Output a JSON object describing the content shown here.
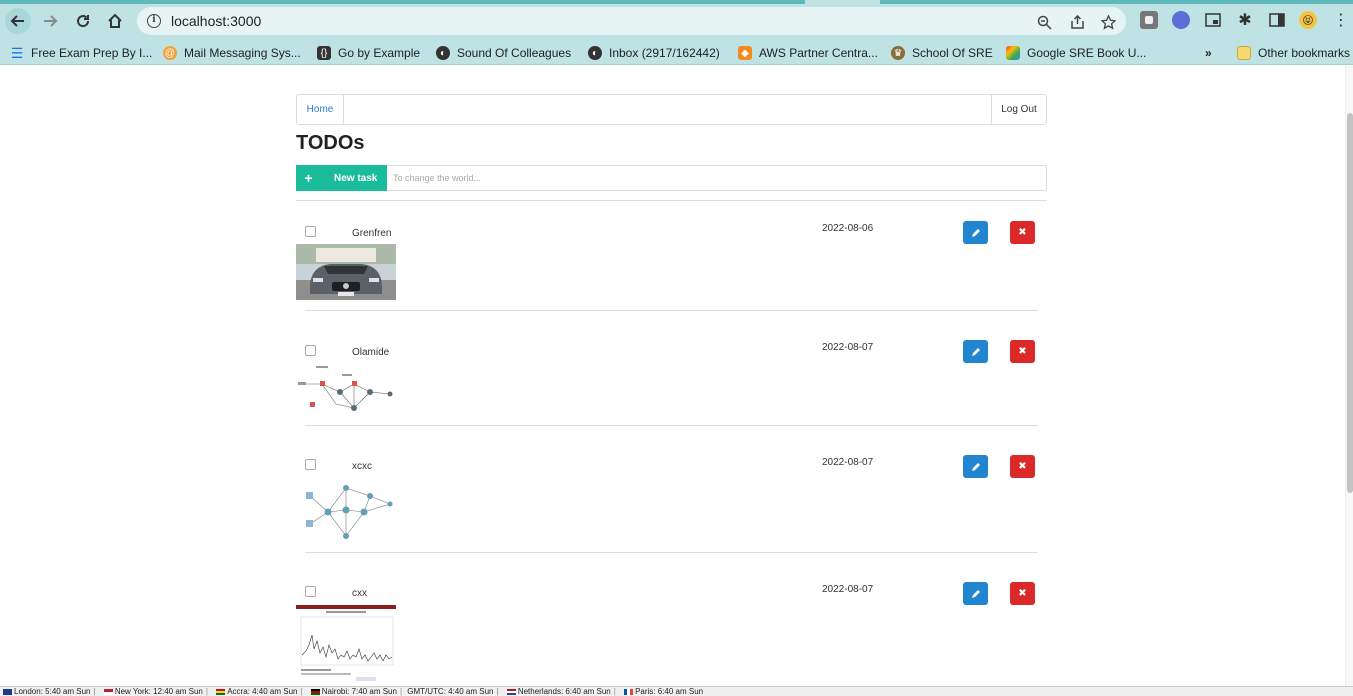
{
  "browser": {
    "url": "localhost:3000",
    "bookmarks": [
      {
        "label": "Free Exam Prep By I...",
        "icon": "list-icon",
        "color": "#1a73e8"
      },
      {
        "label": "Mail Messaging Sys...",
        "icon": "mail-icon",
        "color": "#f2a23a"
      },
      {
        "label": "Go by Example",
        "icon": "code-icon",
        "color": "#333333"
      },
      {
        "label": "Sound Of Colleagues",
        "icon": "globe-icon",
        "color": "#333333"
      },
      {
        "label": "Inbox (2917/162442)",
        "icon": "globe-icon",
        "color": "#333333"
      },
      {
        "label": "AWS Partner Centra...",
        "icon": "cube-icon",
        "color": "#f58a1f"
      },
      {
        "label": "School Of SRE",
        "icon": "crest-icon",
        "color": "#8a6d3b"
      },
      {
        "label": "Google SRE Book U...",
        "icon": "colorful-icon",
        "color": "#6b4fbb"
      }
    ],
    "overflow_label": "»",
    "other_bookmarks": "Other bookmarks"
  },
  "app": {
    "nav": {
      "home": "Home",
      "logout": "Log Out"
    },
    "title": "TODOs",
    "new_task": {
      "plus": "+",
      "label": "New task",
      "placeholder": "To change the world..."
    },
    "tasks": [
      {
        "title": "Grenfren",
        "date": "2022-08-06",
        "image": "car-photo",
        "checked": false
      },
      {
        "title": "Olamide",
        "date": "2022-08-07",
        "image": "network-diagram-1",
        "checked": false
      },
      {
        "title": "xcxc",
        "date": "2022-08-07",
        "image": "network-diagram-2",
        "checked": false
      },
      {
        "title": "cxx",
        "date": "2022-08-07",
        "image": "line-chart",
        "checked": false
      }
    ]
  },
  "colors": {
    "chrome": "#bfe3e4",
    "new_task_button": "#1bbc9b",
    "edit_button": "#2285d0",
    "delete_button": "#db2828",
    "link": "#2a7ec6"
  },
  "statusbar": {
    "clocks": [
      {
        "text": "London: 5:40 am Sun",
        "flag": "uk"
      },
      {
        "text": "New York: 12:40 am Sun",
        "flag": "us"
      },
      {
        "text": "Accra: 4:40 am Sun",
        "flag": "gh"
      },
      {
        "text": "Nairobi: 7:40 am Sun",
        "flag": "ke"
      },
      {
        "text": "GMT/UTC: 4:40 am Sun",
        "flag": ""
      },
      {
        "text": "Netherlands: 6:40 am Sun",
        "flag": "nl"
      },
      {
        "text": "Paris: 6:40 am Sun",
        "flag": "fr"
      }
    ]
  }
}
